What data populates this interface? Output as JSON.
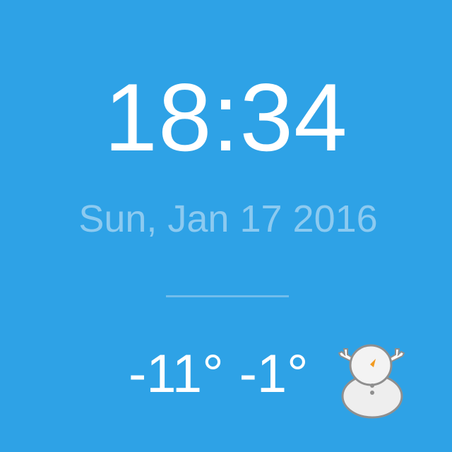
{
  "clock": {
    "time": "18:34",
    "date": "Sun, Jan 17 2016"
  },
  "weather": {
    "low": "-11°",
    "high": "-1°",
    "icon": "snowman-icon"
  },
  "colors": {
    "background": "#2ea2e6",
    "time_text": "#ffffff",
    "date_text": "#8ccaf0",
    "divider": "#72bdeb"
  }
}
